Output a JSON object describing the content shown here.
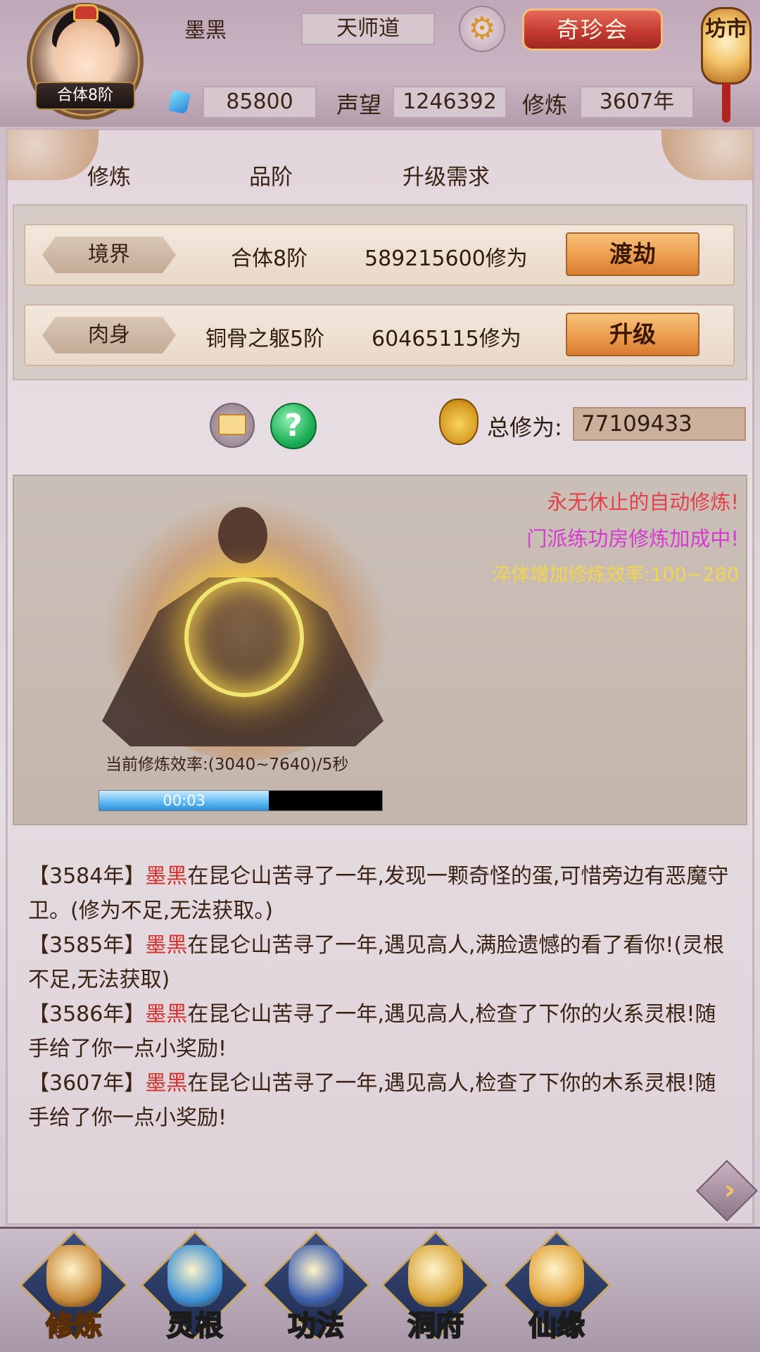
{
  "player": {
    "name": "墨黑",
    "realm_badge": "合体8阶",
    "sect": "天师道",
    "spirit_stones": "85800",
    "reputation_label": "声望",
    "reputation": "1246392",
    "cultivation_label": "修炼",
    "cultivation_years": "3607年"
  },
  "topbar": {
    "treasure_button": "奇珍会",
    "market_lantern": "坊市"
  },
  "headers": {
    "col1": "修炼",
    "col2": "品阶",
    "col3": "升级需求"
  },
  "rows": [
    {
      "label": "境界",
      "grade": "合体8阶",
      "requirement": "589215600修为",
      "button": "渡劫"
    },
    {
      "label": "肉身",
      "grade": "铜骨之躯5阶",
      "requirement": "60465115修为",
      "button": "升级"
    }
  ],
  "total": {
    "label": "总修为:",
    "value": "77109433"
  },
  "status_messages": [
    "永无休止的自动修炼!",
    "门派练功房修炼加成中!",
    "淬体增加修炼效率:100~280"
  ],
  "cultivation": {
    "rate_text": "当前修炼效率:(3040~7640)/5秒",
    "progress_time": "00:03",
    "progress_fraction": 0.6
  },
  "logs": [
    {
      "year": "【3584年】",
      "name": "墨黑",
      "text": "在昆仑山苦寻了一年,发现一颗奇怪的蛋,可惜旁边有恶魔守卫。(修为不足,无法获取。)"
    },
    {
      "year": "【3585年】",
      "name": "墨黑",
      "text": "在昆仑山苦寻了一年,遇见高人,满脸遗憾的看了看你!(灵根不足,无法获取)"
    },
    {
      "year": "【3586年】",
      "name": "墨黑",
      "text": "在昆仑山苦寻了一年,遇见高人,检查了下你的火系灵根!随手给了你一点小奖励!"
    },
    {
      "year": "【3607年】",
      "name": "墨黑",
      "text": "在昆仑山苦寻了一年,遇见高人,检查了下你的木系灵根!随手给了你一点小奖励!"
    }
  ],
  "nav": [
    {
      "label": "修炼",
      "icon": "monk-icon",
      "active": true
    },
    {
      "label": "灵根",
      "icon": "yin-yang-sword-icon",
      "active": false
    },
    {
      "label": "功法",
      "icon": "book-icon",
      "active": false
    },
    {
      "label": "洞府",
      "icon": "pavilion-icon",
      "active": false
    },
    {
      "label": "仙缘",
      "icon": "gourd-icon",
      "active": false
    }
  ],
  "colors": {
    "log_name": "#d3302c",
    "msg_red": "#e2424b",
    "msg_magenta": "#d83ad1",
    "msg_yellow": "#f2d54a",
    "nav_active": "#ffd23d"
  }
}
